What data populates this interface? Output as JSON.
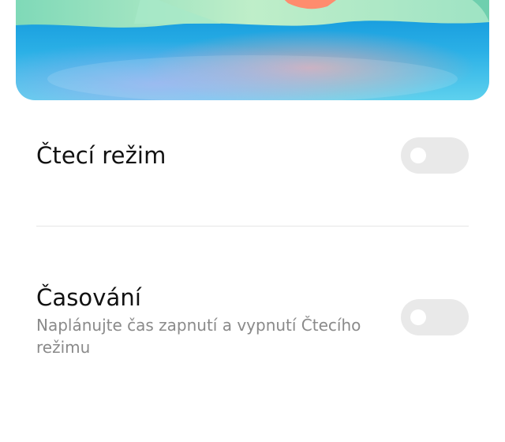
{
  "reading_mode": {
    "title": "Čtecí režim",
    "toggle_on": false
  },
  "schedule": {
    "title": "Časování",
    "subtitle": "Naplánujte čas zapnutí a vypnutí Čtecího režimu",
    "toggle_on": false
  },
  "colors": {
    "toggle_track": "#e9e9e9",
    "toggle_knob": "#ffffff",
    "title_text": "#111111",
    "subtitle_text": "#8a8a8a",
    "divider": "#e6e6e6",
    "preview_sky_top": "#0a8fd8",
    "preview_sky_bottom": "#5ed1ee"
  }
}
